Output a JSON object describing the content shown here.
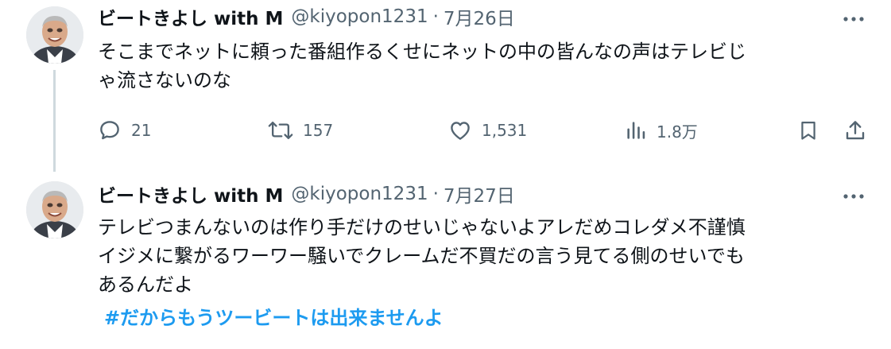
{
  "tweets": [
    {
      "name": "ビートきよし with M",
      "handle": "@kiyopon1231",
      "separator": "·",
      "date": "7月26日",
      "text_lines": [
        "そこまでネットに頼った番組作るくせにネットの中の皆んなの声はテレビじ",
        "ゃ流さないのな"
      ],
      "hashtag": "",
      "actions": {
        "replies": "21",
        "retweets": "157",
        "likes": "1,531",
        "views": "1.8万"
      }
    },
    {
      "name": "ビートきよし with M",
      "handle": "@kiyopon1231",
      "separator": "·",
      "date": "7月27日",
      "text_lines": [
        "テレビつまんないのは作り手だけのせいじゃないよアレだめコレダメ不謹慎",
        "イジメに繋がるワーワー騒いでクレームだ不買だの言う見てる側のせいでも",
        "あるんだよ"
      ],
      "hashtag": "#だからもうツービートは出来ませんよ"
    }
  ],
  "icons": {
    "more": "more-horizontal-icon",
    "reply": "reply-icon",
    "retweet": "retweet-icon",
    "like": "heart-icon",
    "views": "views-chart-icon",
    "bookmark": "bookmark-icon",
    "share": "share-icon"
  },
  "colors": {
    "text": "#0f1419",
    "secondary": "#536471",
    "link": "#1d9bf0",
    "thread_line": "#cfd9de",
    "background": "#ffffff"
  }
}
